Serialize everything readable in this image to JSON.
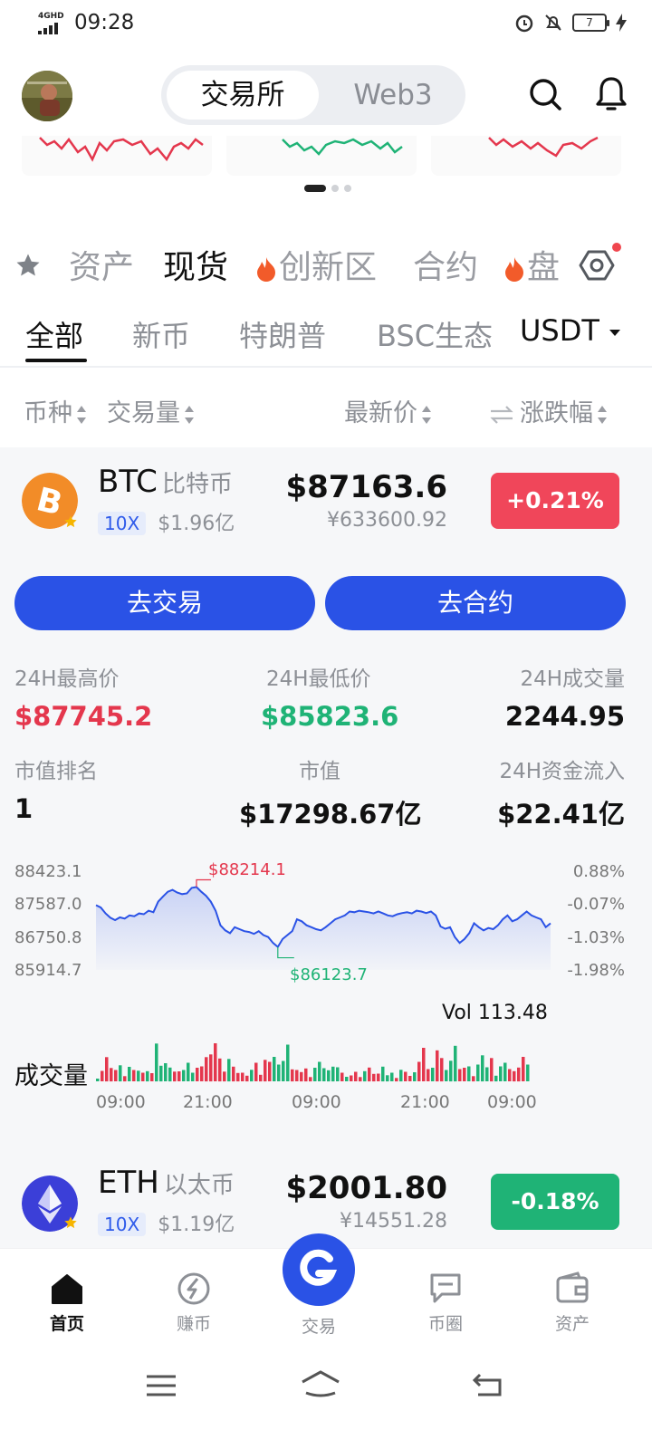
{
  "status_bar": {
    "network": "4GHD",
    "time": "09:28",
    "battery": "7"
  },
  "header": {
    "segment_active": "交易所",
    "segment_inactive": "Web3"
  },
  "main_tabs": [
    {
      "label": "资产"
    },
    {
      "label": "现货"
    },
    {
      "label": "创新区"
    },
    {
      "label": "合约"
    },
    {
      "label": "盘"
    }
  ],
  "sub_tabs": [
    {
      "label": "全部"
    },
    {
      "label": "新币"
    },
    {
      "label": "特朗普"
    },
    {
      "label": "BSC生态"
    }
  ],
  "quote_currency": "USDT",
  "columns": {
    "coin": "币种",
    "volume": "交易量",
    "price": "最新价",
    "change": "涨跌幅"
  },
  "btc": {
    "symbol": "BTC",
    "name": "比特币",
    "leverage": "10X",
    "volume": "$1.96亿",
    "price": "$87163.6",
    "price_cny": "¥633600.92",
    "change": "+0.21%",
    "trade_button": "去交易",
    "contract_button": "去合约",
    "stats": {
      "high_label": "24H最高价",
      "high": "$87745.2",
      "low_label": "24H最低价",
      "low": "$85823.6",
      "vol_label": "24H成交量",
      "vol": "2244.95",
      "rank_label": "市值排名",
      "rank": "1",
      "mcap_label": "市值",
      "mcap": "$17298.67亿",
      "inflow_label": "24H资金流入",
      "inflow": "$22.41亿"
    }
  },
  "chart_data": {
    "type": "area",
    "yticks_left": [
      "88423.1",
      "87587.0",
      "86750.8",
      "85914.7"
    ],
    "yticks_right": [
      "0.88%",
      "-0.07%",
      "-1.03%",
      "-1.98%"
    ],
    "ylim": [
      85914.7,
      88423.1
    ],
    "high_annotation": "$88214.1",
    "low_annotation": "$86123.7",
    "volume_readout": "Vol 113.48",
    "volume_label": "成交量",
    "xticks": [
      "09:00",
      "21:00",
      "09:00",
      "21:00",
      "09:00"
    ],
    "series": [
      {
        "values": [
          87560,
          87500,
          87350,
          87240,
          87180,
          87250,
          87220,
          87300,
          87280,
          87350,
          87330,
          87420,
          87380,
          87650,
          87780,
          87900,
          87950,
          87880,
          87840,
          87860,
          88000,
          88020,
          87900,
          87800,
          87650,
          87420,
          87050,
          86920,
          86850,
          87000,
          86950,
          86900,
          86880,
          86830,
          86900,
          86800,
          86750,
          86600,
          86500,
          86700,
          86800,
          86900,
          87200,
          87150,
          87050,
          87000,
          86950,
          86920,
          87000,
          87100,
          87200,
          87250,
          87300,
          87400,
          87380,
          87420,
          87400,
          87380,
          87350,
          87400,
          87350,
          87300,
          87280,
          87330,
          87360,
          87380,
          87350,
          87420,
          87400,
          87360,
          87400,
          87300,
          87020,
          86960,
          87000,
          86750,
          86600,
          86700,
          86850,
          87100,
          87000,
          86920,
          86980,
          86950,
          87050,
          87200,
          87300,
          87150,
          87200,
          87300,
          87400,
          87300,
          87250,
          87200,
          87000,
          87100
        ]
      }
    ]
  },
  "eth": {
    "symbol": "ETH",
    "name": "以太币",
    "leverage": "10X",
    "volume": "$1.19亿",
    "price": "$2001.80",
    "price_cny": "¥14551.28",
    "change": "-0.18%"
  },
  "bottom_nav": [
    {
      "label": "首页"
    },
    {
      "label": "赚币"
    },
    {
      "label": "交易"
    },
    {
      "label": "币圈"
    },
    {
      "label": "资产"
    }
  ],
  "colors": {
    "accent": "#2a52e6",
    "up": "#e4374d",
    "down": "#1fb376"
  }
}
